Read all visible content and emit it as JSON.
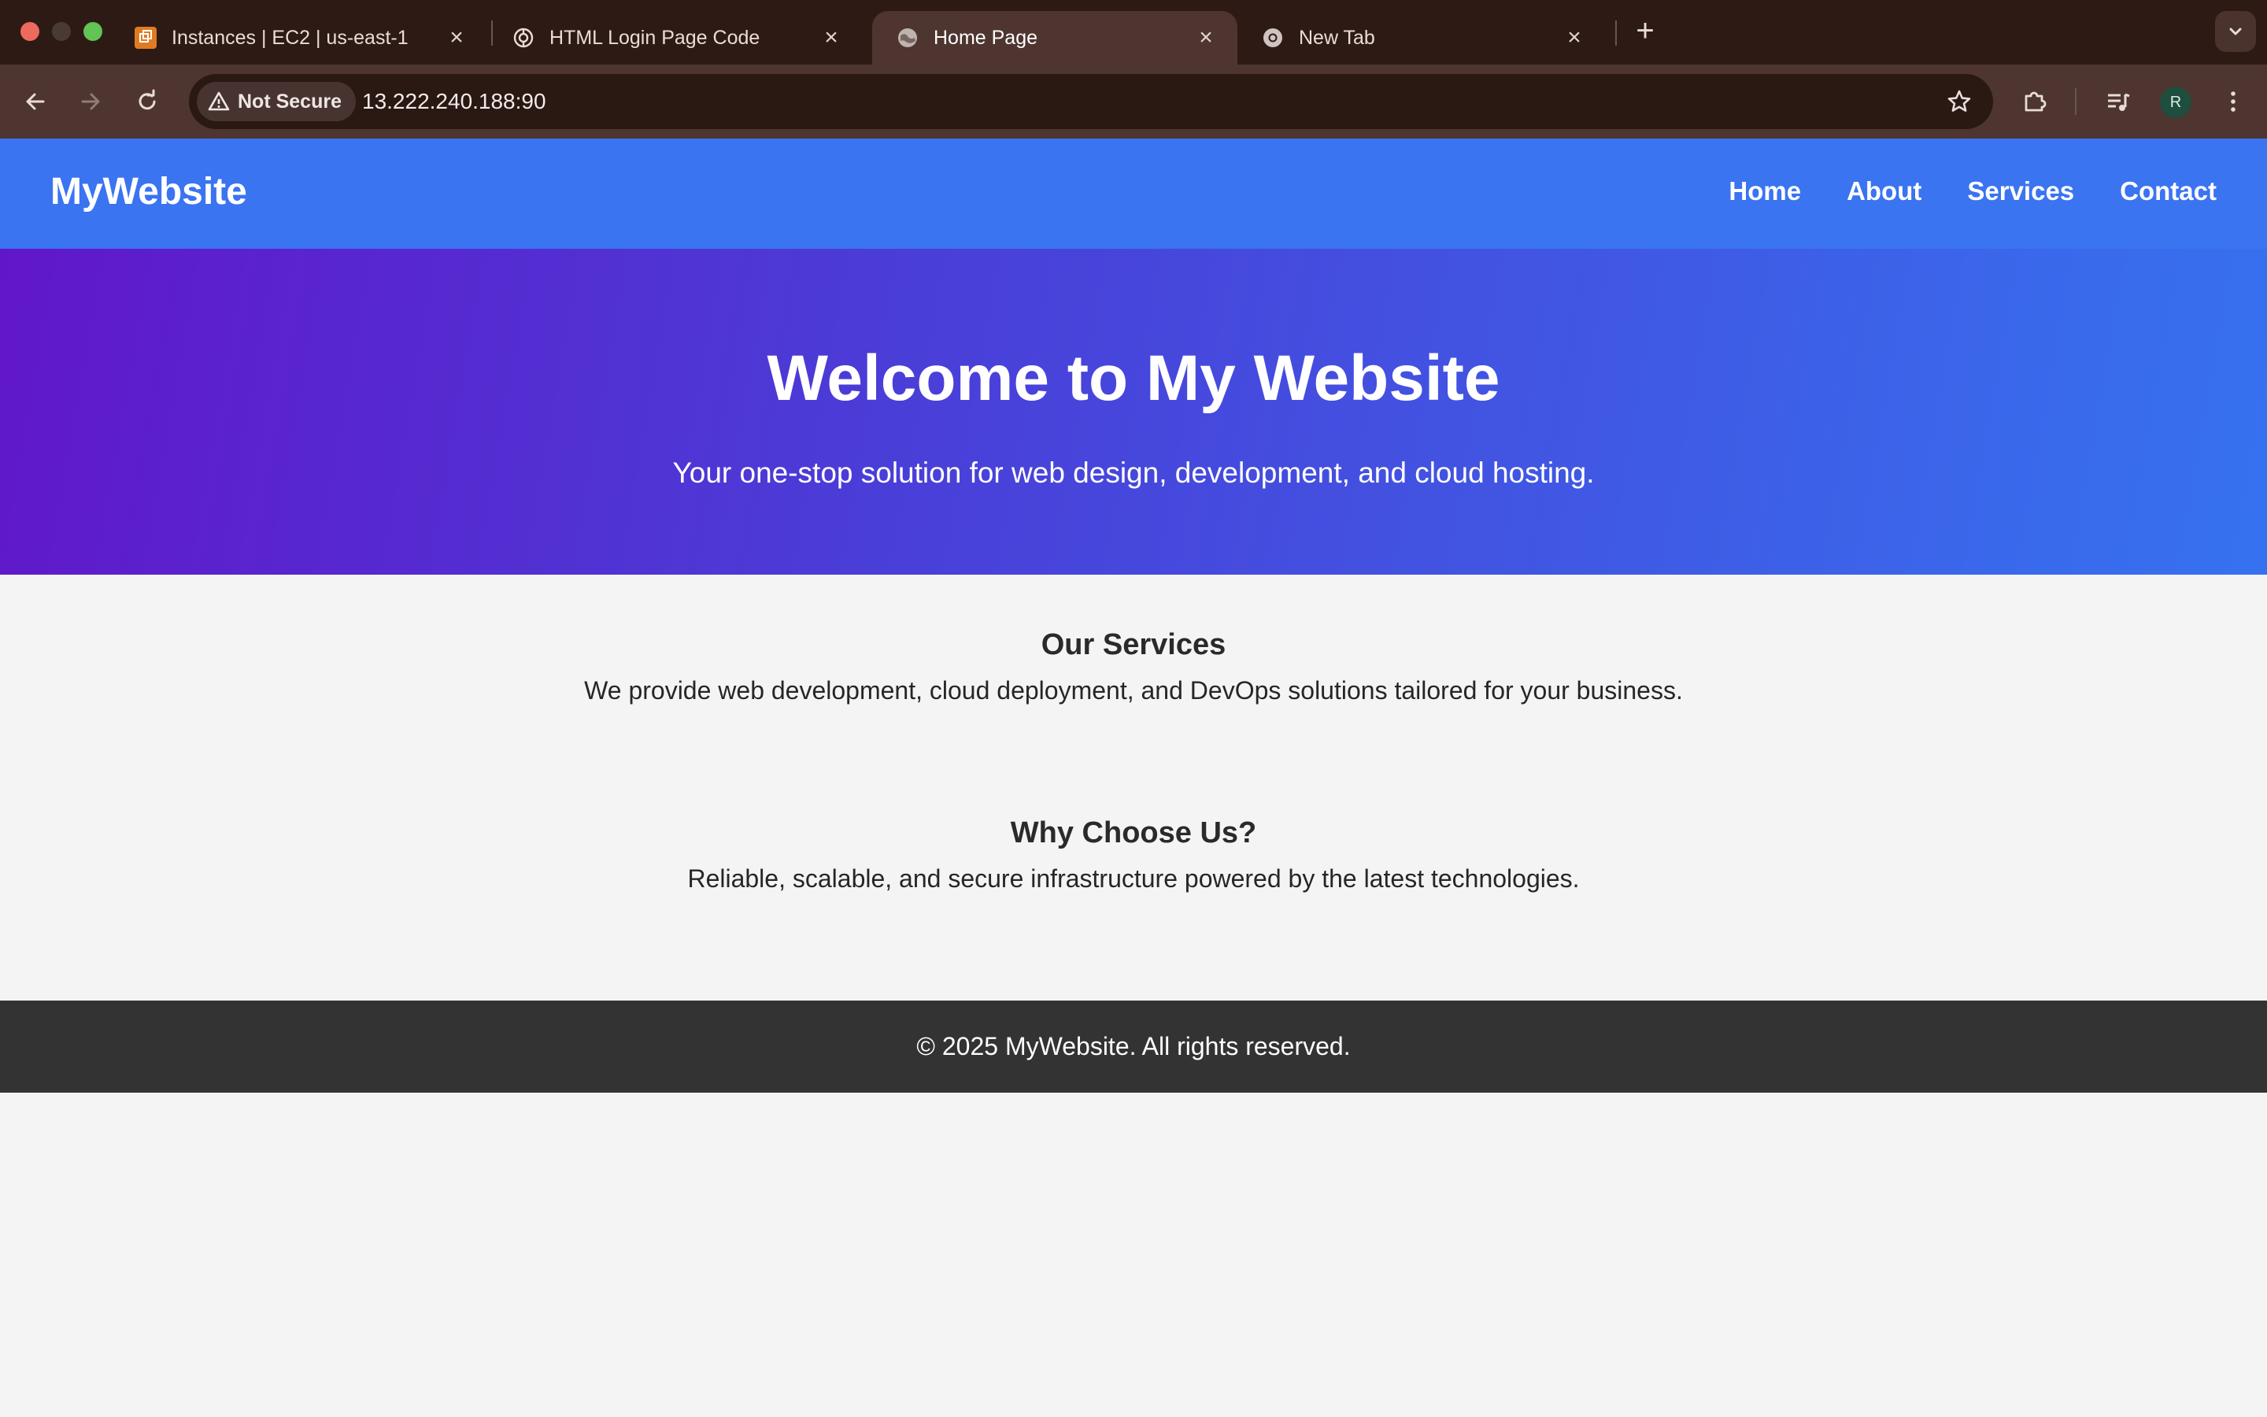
{
  "browser": {
    "tabs": [
      {
        "title": "Instances | EC2 | us-east-1",
        "icon": "aws-ec2-icon",
        "active": false
      },
      {
        "title": "HTML Login Page Code",
        "icon": "chatgpt-icon",
        "active": false
      },
      {
        "title": "Home Page",
        "icon": "globe-icon",
        "active": true
      },
      {
        "title": "New Tab",
        "icon": "chrome-icon",
        "active": false
      }
    ],
    "security_label": "Not Secure",
    "url": "13.222.240.188:90",
    "profile_initial": "R"
  },
  "site": {
    "brand": "MyWebsite",
    "nav": [
      "Home",
      "About",
      "Services",
      "Contact"
    ],
    "hero": {
      "title": "Welcome to My Website",
      "subtitle": "Your one-stop solution for web design, development, and cloud hosting."
    },
    "sections": [
      {
        "heading": "Our Services",
        "text": "We provide web development, cloud deployment, and DevOps solutions tailored for your business."
      },
      {
        "heading": "Why Choose Us?",
        "text": "Reliable, scalable, and secure infrastructure powered by the latest technologies."
      }
    ],
    "footer": "© 2025 MyWebsite. All rights reserved."
  },
  "colors": {
    "navbar": "#3b74f1",
    "hero_start": "#6117c9",
    "hero_end": "#3672f0",
    "footer": "#333333",
    "page_bg": "#f4f4f4"
  }
}
